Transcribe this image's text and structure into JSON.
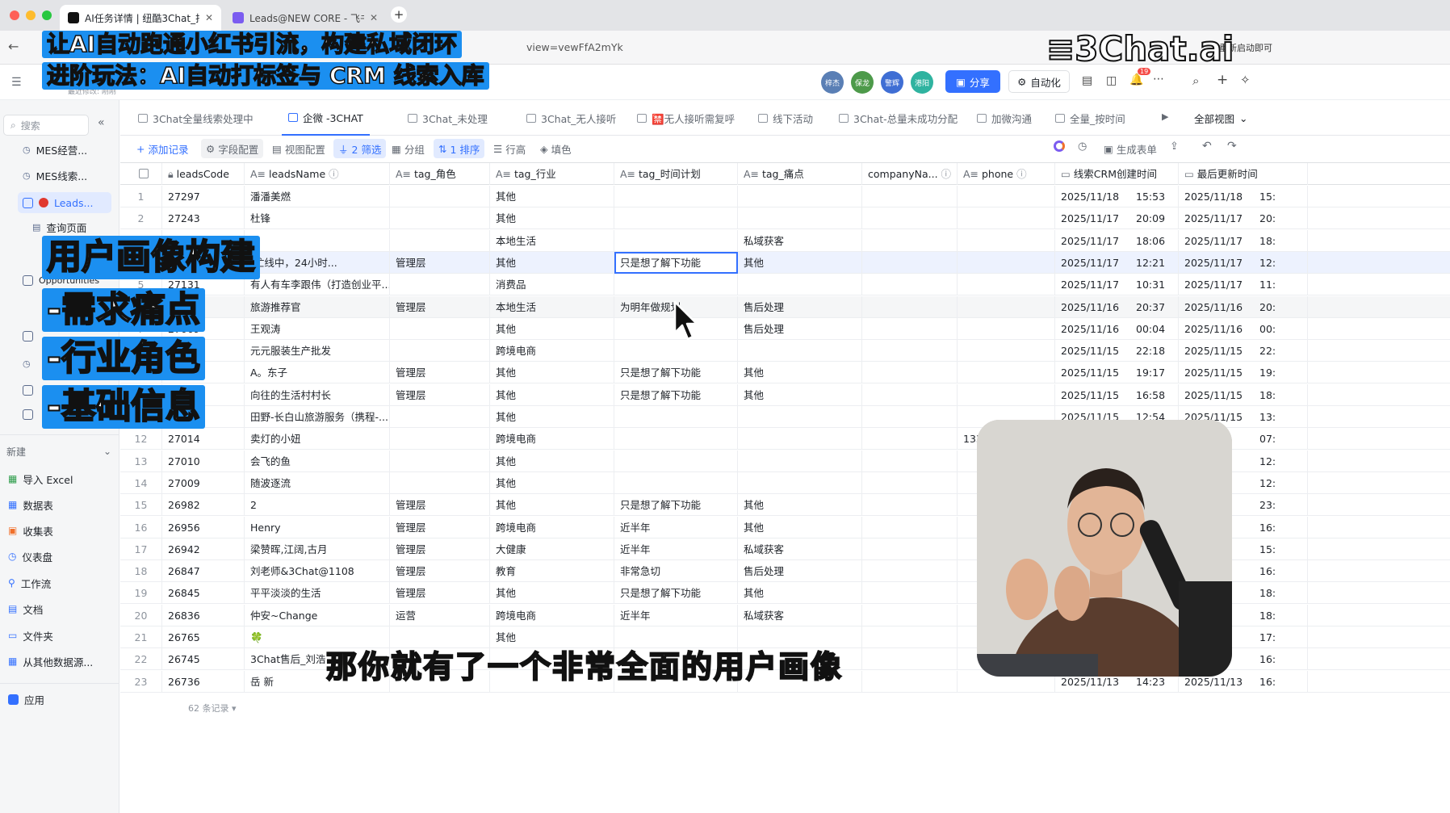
{
  "browser": {
    "tabs": [
      {
        "label": "AI任务详情 | 纽酷3Chat_抖音..."
      },
      {
        "label": "Leads@NEW CORE - 飞书云文..."
      }
    ],
    "new_tab": "+",
    "url": "view=vewFfA2mYk",
    "right_hint": "重新启动即可"
  },
  "overlay": {
    "title_line1": "让AI自动跑通小红书引流，构建私域闭环",
    "title_line2": "进阶玩法：AI自动打标签与 CRM 线索入库",
    "logo": "3Chat.ai",
    "tag_main": "用户画像构建",
    "tag_items": [
      "-需求痛点",
      "-行业角色",
      "-基础信息"
    ],
    "subtitle": "那你就有了一个非常全面的用户画像"
  },
  "header": {
    "avatars": [
      "梓杰",
      "保龙",
      "警辉",
      "港阳"
    ],
    "share_label": "分享",
    "automation_label": "自动化",
    "notification_count": "19",
    "last_modified": "最近修改: 刚刚"
  },
  "sidebar": {
    "search_placeholder": "搜索",
    "items": [
      {
        "label": "MES经营..."
      },
      {
        "label": "MES线索..."
      },
      {
        "label": "Leads..."
      },
      {
        "label": "查询页面"
      },
      {
        "label": "Opportunities"
      }
    ],
    "new_label": "新建",
    "create_items": [
      "导入 Excel",
      "数据表",
      "收集表",
      "仪表盘",
      "工作流",
      "文档",
      "文件夹",
      "从其他数据源..."
    ],
    "app_label": "应用"
  },
  "view_tabs": [
    "3Chat全量线索处理中",
    "企微 -3CHAT",
    "3Chat_未处理",
    "3Chat_无人接听",
    "🈲无人接听需复呼",
    "线下活动",
    "3Chat-总量未成功分配",
    "加微沟通",
    "全量_按时间",
    "全部视图"
  ],
  "toolbar": {
    "add_record": "添加记录",
    "field_config": "字段配置",
    "view_config": "视图配置",
    "filter": "2 筛选",
    "group": "分组",
    "sort": "1 排序",
    "row_height": "行高",
    "fill_color": "填色",
    "generate_form": "生成表单"
  },
  "columns": [
    "leadsCode",
    "leadsName",
    "tag_角色",
    "tag_行业",
    "tag_时间计划",
    "tag_痛点",
    "companyNa...",
    "phone",
    "线索CRM创建时间",
    "最后更新时间"
  ],
  "rows": [
    {
      "n": "1",
      "code": "27297",
      "name": "潘潘美燃",
      "role": "",
      "industry": "其他",
      "plan": "",
      "pain": "",
      "company": "",
      "phone": "",
      "c_date": "2025/11/18",
      "c_time": "15:53",
      "u_date": "2025/11/18",
      "u_time": "15:"
    },
    {
      "n": "2",
      "code": "27243",
      "name": "杜锋",
      "role": "",
      "industry": "其他",
      "plan": "",
      "pain": "",
      "company": "",
      "phone": "",
      "c_date": "2025/11/17",
      "c_time": "20:09",
      "u_date": "2025/11/17",
      "u_time": "20:"
    },
    {
      "n": "3",
      "code": "",
      "name": "",
      "role": "",
      "industry": "本地生活",
      "plan": "",
      "pain": "私域获客",
      "company": "",
      "phone": "",
      "c_date": "2025/11/17",
      "c_time": "18:06",
      "u_date": "2025/11/17",
      "u_time": "18:"
    },
    {
      "n": "4",
      "code": "",
      "name": "(忙线中，24小时...",
      "role": "管理层",
      "industry": "其他",
      "plan": "只是想了解下功能",
      "pain": "其他",
      "company": "",
      "phone": "",
      "c_date": "2025/11/17",
      "c_time": "12:21",
      "u_date": "2025/11/17",
      "u_time": "12:"
    },
    {
      "n": "5",
      "code": "27131",
      "name": "有人有车李跟伟（打造创业平...",
      "role": "",
      "industry": "消费品",
      "plan": "",
      "pain": "",
      "company": "",
      "phone": "",
      "c_date": "2025/11/17",
      "c_time": "10:31",
      "u_date": "2025/11/17",
      "u_time": "11:"
    },
    {
      "n": "6",
      "code": "",
      "name": "旅游推荐官",
      "role": "管理层",
      "industry": "本地生活",
      "plan": "为明年做规划",
      "pain": "售后处理",
      "company": "",
      "phone": "",
      "c_date": "2025/11/16",
      "c_time": "20:37",
      "u_date": "2025/11/16",
      "u_time": "20:"
    },
    {
      "n": "7",
      "code": "27069",
      "name": "王观涛",
      "role": "",
      "industry": "其他",
      "plan": "",
      "pain": "售后处理",
      "company": "",
      "phone": "",
      "c_date": "2025/11/16",
      "c_time": "00:04",
      "u_date": "2025/11/16",
      "u_time": "00:"
    },
    {
      "n": "8",
      "code": "",
      "name": "元元服装生产批发",
      "role": "",
      "industry": "跨境电商",
      "plan": "",
      "pain": "",
      "company": "",
      "phone": "",
      "c_date": "2025/11/15",
      "c_time": "22:18",
      "u_date": "2025/11/15",
      "u_time": "22:"
    },
    {
      "n": "9",
      "code": "",
      "name": "A。东子",
      "role": "管理层",
      "industry": "其他",
      "plan": "只是想了解下功能",
      "pain": "其他",
      "company": "",
      "phone": "",
      "c_date": "2025/11/15",
      "c_time": "19:17",
      "u_date": "2025/11/15",
      "u_time": "19:"
    },
    {
      "n": "10",
      "code": "",
      "name": "向往的生活村村长",
      "role": "管理层",
      "industry": "其他",
      "plan": "只是想了解下功能",
      "pain": "其他",
      "company": "",
      "phone": "",
      "c_date": "2025/11/15",
      "c_time": "16:58",
      "u_date": "2025/11/15",
      "u_time": "18:"
    },
    {
      "n": "11",
      "code": "",
      "name": "田野-长白山旅游服务（携程-...",
      "role": "",
      "industry": "其他",
      "plan": "",
      "pain": "",
      "company": "",
      "phone": "",
      "c_date": "2025/11/15",
      "c_time": "12:54",
      "u_date": "2025/11/15",
      "u_time": "13:"
    },
    {
      "n": "12",
      "code": "27014",
      "name": "卖灯的小妞",
      "role": "",
      "industry": "跨境电商",
      "plan": "",
      "pain": "",
      "company": "",
      "phone": "13322",
      "c_date": "",
      "c_time": "",
      "u_date": "/18",
      "u_time": "07:"
    },
    {
      "n": "13",
      "code": "27010",
      "name": "会飞的鱼",
      "role": "",
      "industry": "其他",
      "plan": "",
      "pain": "",
      "company": "",
      "phone": "",
      "c_date": "",
      "c_time": "",
      "u_date": "5",
      "u_time": "12:"
    },
    {
      "n": "14",
      "code": "27009",
      "name": "随波逐流",
      "role": "",
      "industry": "其他",
      "plan": "",
      "pain": "",
      "company": "",
      "phone": "",
      "c_date": "",
      "c_time": "",
      "u_date": "",
      "u_time": "12:"
    },
    {
      "n": "15",
      "code": "26982",
      "name": "2",
      "role": "管理层",
      "industry": "其他",
      "plan": "只是想了解下功能",
      "pain": "其他",
      "company": "",
      "phone": "",
      "c_date": "",
      "c_time": "",
      "u_date": "",
      "u_time": "23:"
    },
    {
      "n": "16",
      "code": "26956",
      "name": "Henry",
      "role": "管理层",
      "industry": "跨境电商",
      "plan": "近半年",
      "pain": "其他",
      "company": "",
      "phone": "",
      "c_date": "",
      "c_time": "",
      "u_date": "",
      "u_time": "16:"
    },
    {
      "n": "17",
      "code": "26942",
      "name": "梁赞晖,江阔,古月",
      "role": "管理层",
      "industry": "大健康",
      "plan": "近半年",
      "pain": "私域获客",
      "company": "",
      "phone": "",
      "c_date": "",
      "c_time": "",
      "u_date": "",
      "u_time": "15:"
    },
    {
      "n": "18",
      "code": "26847",
      "name": "刘老师&3Chat@1108",
      "role": "管理层",
      "industry": "教育",
      "plan": "非常急切",
      "pain": "售后处理",
      "company": "",
      "phone": "",
      "c_date": "",
      "c_time": "",
      "u_date": "",
      "u_time": "16:"
    },
    {
      "n": "19",
      "code": "26845",
      "name": "平平淡淡的生活",
      "role": "管理层",
      "industry": "其他",
      "plan": "只是想了解下功能",
      "pain": "其他",
      "company": "",
      "phone": "",
      "c_date": "",
      "c_time": "",
      "u_date": "",
      "u_time": "18:"
    },
    {
      "n": "20",
      "code": "26836",
      "name": "仲安~Change",
      "role": "运营",
      "industry": "跨境电商",
      "plan": "近半年",
      "pain": "私域获客",
      "company": "",
      "phone": "",
      "c_date": "",
      "c_time": "",
      "u_date": "",
      "u_time": "18:"
    },
    {
      "n": "21",
      "code": "26765",
      "name": "🍀",
      "role": "",
      "industry": "其他",
      "plan": "",
      "pain": "",
      "company": "",
      "phone": "",
      "c_date": "",
      "c_time": "",
      "u_date": "",
      "u_time": "17:"
    },
    {
      "n": "22",
      "code": "26745",
      "name": "3Chat售后_刘浩",
      "role": "",
      "industry": "",
      "plan": "",
      "pain": "",
      "company": "",
      "phone": "",
      "c_date": "",
      "c_time": "",
      "u_date": "/13",
      "u_time": "16:"
    },
    {
      "n": "23",
      "code": "26736",
      "name": "岳 新",
      "role": "",
      "industry": "",
      "plan": "",
      "pain": "",
      "company": "",
      "phone": "",
      "c_date": "2025/11/13",
      "c_time": "14:23",
      "u_date": "2025/11/13",
      "u_time": "16:"
    }
  ],
  "footer": {
    "record_count": "62 条记录"
  }
}
